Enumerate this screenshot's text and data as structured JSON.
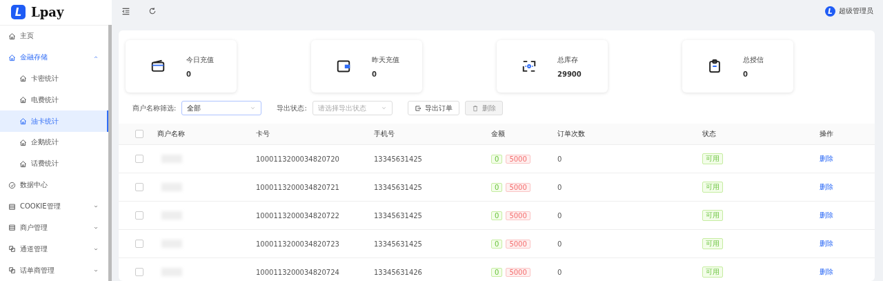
{
  "sidebar": {
    "logo_letter": "L",
    "logo": "Lpay",
    "items": [
      {
        "label": "主页",
        "expanded": false,
        "selected": false
      },
      {
        "label": "金融存储",
        "expanded": true,
        "selected": true,
        "children": [
          {
            "label": "卡密统计",
            "selected": false
          },
          {
            "label": "电费统计",
            "selected": false
          },
          {
            "label": "油卡统计",
            "selected": true
          },
          {
            "label": "企鹅统计",
            "selected": false
          },
          {
            "label": "话费统计",
            "selected": false
          }
        ]
      },
      {
        "label": "数据中心",
        "expanded": false,
        "selected": false
      },
      {
        "label": "COOKIE管理",
        "expanded": false,
        "selected": false
      },
      {
        "label": "商户管理",
        "expanded": false,
        "selected": false
      },
      {
        "label": "通道管理",
        "expanded": false,
        "selected": false
      },
      {
        "label": "话单商管理",
        "expanded": false,
        "selected": false
      }
    ]
  },
  "header": {
    "avatar_letter": "L",
    "user": "超级管理员"
  },
  "stats": [
    {
      "label": "今日充值",
      "value": "0"
    },
    {
      "label": "昨天充值",
      "value": "0"
    },
    {
      "label": "总库存",
      "value": "29900"
    },
    {
      "label": "总授信",
      "value": "0"
    }
  ],
  "filters": {
    "merchant_label": "商户名称筛选:",
    "merchant_value": "全部",
    "export_label": "导出状态:",
    "export_placeholder": "请选择导出状态",
    "export_button": "导出订单",
    "delete_button": "删除",
    "delete_disabled": true
  },
  "table": {
    "select_all_checked": false,
    "columns": [
      "商户名称",
      "卡号",
      "手机号",
      "金额",
      "订单次数",
      "状态",
      "操作"
    ],
    "rows": [
      {
        "checked": false,
        "card_no": "1000113200034820720",
        "phone": "13345631425",
        "amounts": [
          "0",
          "5000"
        ],
        "orders": "0",
        "status": "可用",
        "action": "删除"
      },
      {
        "checked": false,
        "card_no": "1000113200034820721",
        "phone": "13345631425",
        "amounts": [
          "0",
          "5000"
        ],
        "orders": "0",
        "status": "可用",
        "action": "删除"
      },
      {
        "checked": false,
        "card_no": "1000113200034820722",
        "phone": "13345631425",
        "amounts": [
          "0",
          "5000"
        ],
        "orders": "0",
        "status": "可用",
        "action": "删除"
      },
      {
        "checked": false,
        "card_no": "1000113200034820723",
        "phone": "13345631425",
        "amounts": [
          "0",
          "5000"
        ],
        "orders": "0",
        "status": "可用",
        "action": "删除"
      },
      {
        "checked": false,
        "card_no": "1000113200034820724",
        "phone": "13345631426",
        "amounts": [
          "0",
          "5000"
        ],
        "orders": "0",
        "status": "可用",
        "action": "删除"
      }
    ]
  }
}
